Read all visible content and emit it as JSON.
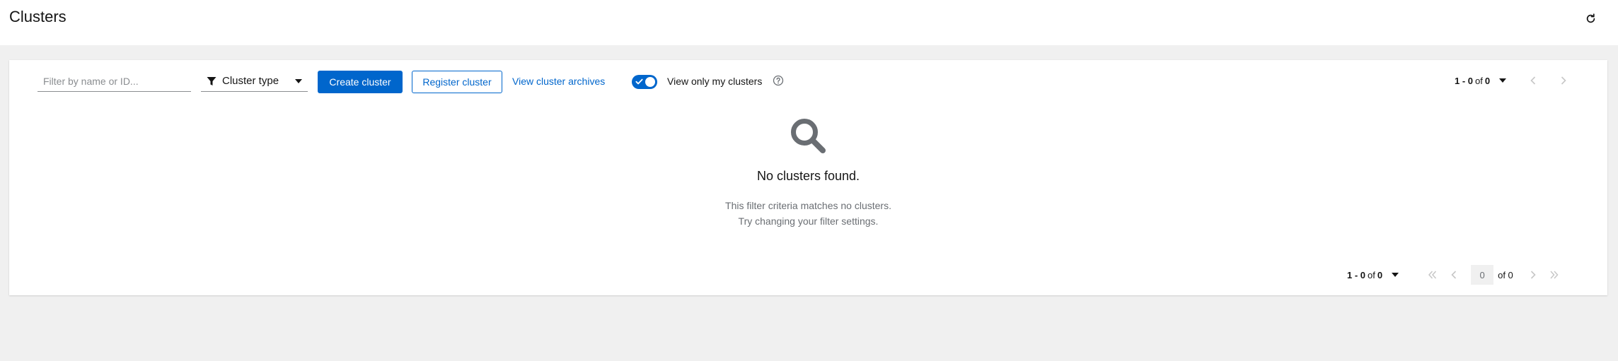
{
  "header": {
    "title": "Clusters",
    "refresh_icon": "refresh-icon"
  },
  "toolbar": {
    "search": {
      "placeholder": "Filter by name or ID...",
      "value": ""
    },
    "filter": {
      "label": "Cluster type",
      "icon": "filter-icon"
    },
    "create_label": "Create cluster",
    "register_label": "Register cluster",
    "archives_label": "View cluster archives",
    "toggle": {
      "label": "View only my clusters",
      "checked": true
    },
    "help_icon": "help-icon"
  },
  "pagination": {
    "range": "1 - 0",
    "of_label": "of",
    "total": "0",
    "page_input": "0",
    "of_pages": "of 0"
  },
  "empty_state": {
    "icon": "search-icon",
    "title": "No clusters found.",
    "line1": "This filter criteria matches no clusters.",
    "line2": "Try changing your filter settings."
  },
  "colors": {
    "accent": "#0066cc",
    "background": "#f0f0f0",
    "icon_gray": "#6a6e73"
  }
}
